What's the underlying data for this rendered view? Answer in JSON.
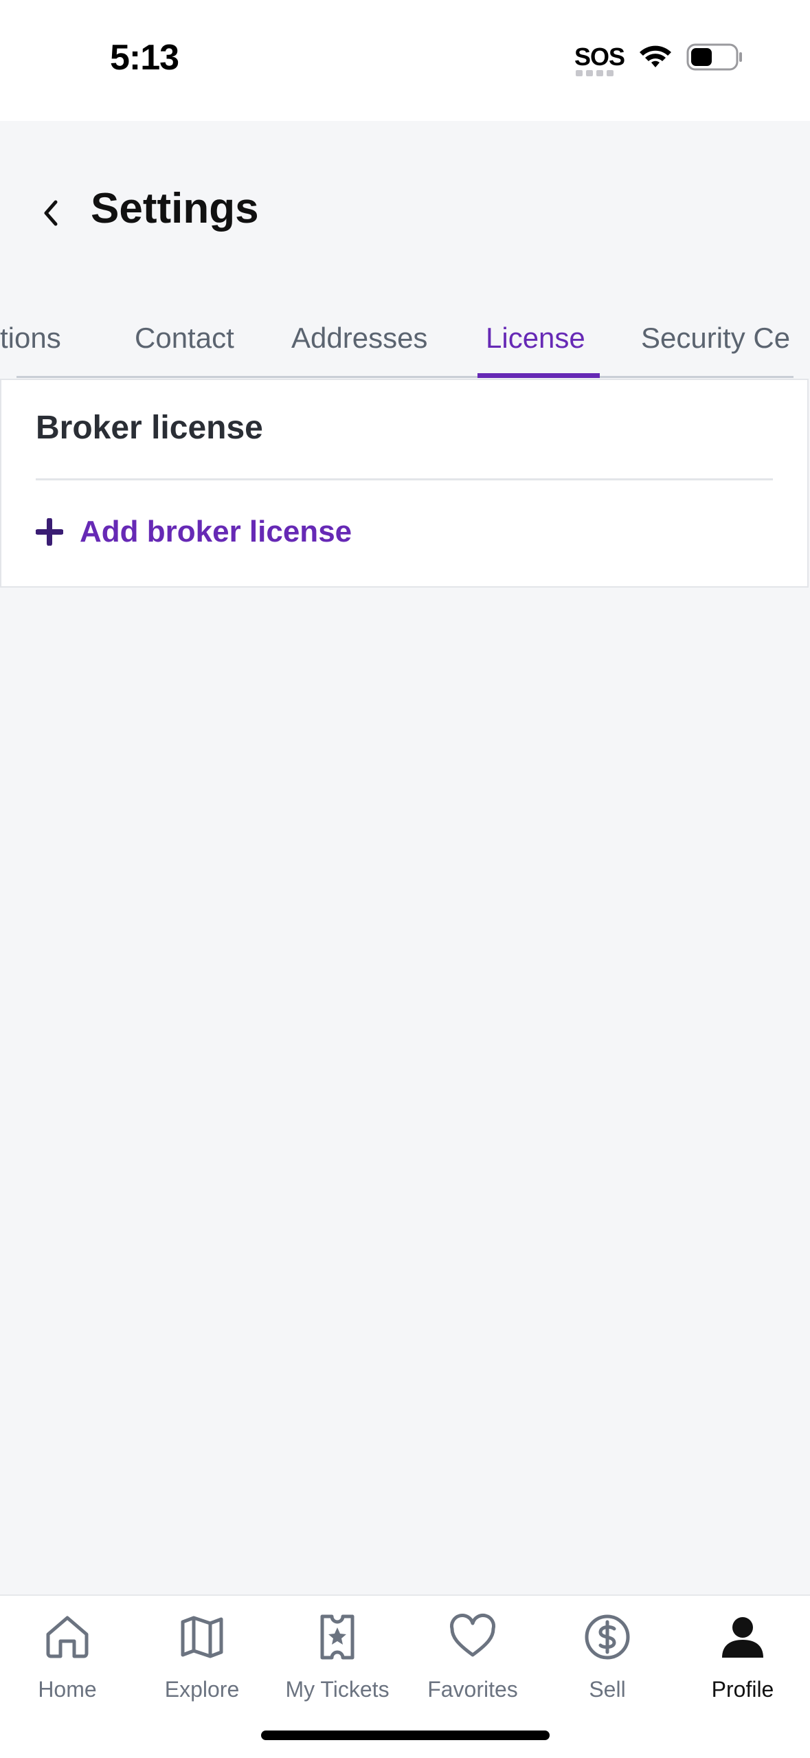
{
  "status_bar": {
    "time": "5:13",
    "sos": "SOS"
  },
  "header": {
    "title": "Settings",
    "back_icon": "chevron-left-icon"
  },
  "tabs": [
    {
      "label": "tions"
    },
    {
      "label": "Contact"
    },
    {
      "label": "Addresses"
    },
    {
      "label": "License",
      "active": true
    },
    {
      "label": "Security Ce"
    }
  ],
  "license_card": {
    "title": "Broker license",
    "add_label": "Add broker license",
    "add_icon": "plus-icon"
  },
  "bottom_nav": [
    {
      "label": "Home",
      "icon": "home-icon"
    },
    {
      "label": "Explore",
      "icon": "map-icon"
    },
    {
      "label": "My Tickets",
      "icon": "ticket-icon"
    },
    {
      "label": "Favorites",
      "icon": "heart-icon"
    },
    {
      "label": "Sell",
      "icon": "dollar-circle-icon"
    },
    {
      "label": "Profile",
      "icon": "person-icon",
      "active": true
    }
  ],
  "colors": {
    "accent": "#6629b5",
    "background": "#f5f6f8",
    "muted": "#6b7380"
  }
}
